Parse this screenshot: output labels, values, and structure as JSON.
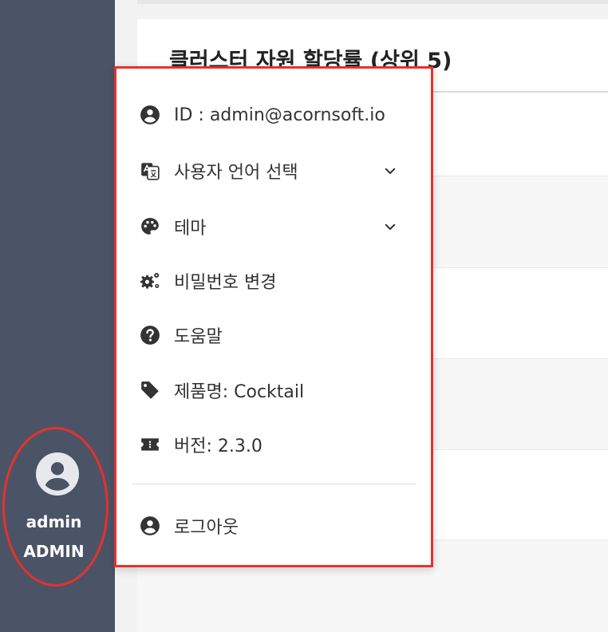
{
  "sidebar": {
    "user_name": "admin",
    "user_role": "ADMIN"
  },
  "main": {
    "card_title": "클러스터 자원 할당률 (상위 5)"
  },
  "user_menu": {
    "items": [
      {
        "label": "ID : admin@acornsoft.io",
        "icon": "account-circle-icon"
      },
      {
        "label": "사용자 언어 선택",
        "icon": "translate-icon",
        "expandable": true
      },
      {
        "label": "테마",
        "icon": "palette-icon",
        "expandable": true
      },
      {
        "label": "비밀번호 변경",
        "icon": "settings-gears-icon"
      },
      {
        "label": "도움말",
        "icon": "help-circle-icon"
      },
      {
        "label": "제품명: Cocktail",
        "icon": "tag-icon"
      },
      {
        "label": "버전: 2.3.0",
        "icon": "ticket-icon"
      }
    ],
    "logout_label": "로그아웃"
  },
  "colors": {
    "sidebar_bg": "#4a5466",
    "highlight_red": "#e8302b",
    "icon_dark": "#333333"
  }
}
